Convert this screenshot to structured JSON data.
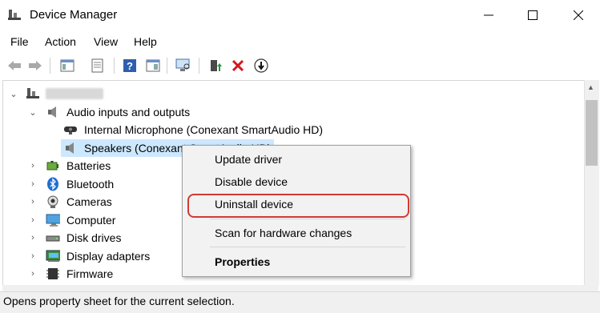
{
  "window": {
    "title": "Device Manager",
    "controls": [
      "minimize",
      "maximize",
      "close"
    ]
  },
  "menu": [
    "File",
    "Action",
    "View",
    "Help"
  ],
  "toolbar": {
    "icons": [
      "back-arrow-icon",
      "forward-arrow-icon",
      "show-hide-console-tree-icon",
      "properties-icon",
      "help-icon",
      "action-pane-icon",
      "scan-hardware-icon",
      "update-driver-icon",
      "uninstall-icon",
      "disable-device-icon"
    ]
  },
  "tree": {
    "root": "",
    "categories": [
      {
        "label": "Audio inputs and outputs",
        "expanded": true,
        "children": [
          "Internal Microphone (Conexant SmartAudio HD)",
          "Speakers (Conexant SmartAudio HD)"
        ]
      },
      {
        "label": "Batteries"
      },
      {
        "label": "Bluetooth"
      },
      {
        "label": "Cameras"
      },
      {
        "label": "Computer"
      },
      {
        "label": "Disk drives"
      },
      {
        "label": "Display adapters"
      },
      {
        "label": "Firmware"
      }
    ]
  },
  "context_menu": {
    "items": [
      "Update driver",
      "Disable device",
      "Uninstall device",
      "Scan for hardware changes",
      "Properties"
    ],
    "highlighted": "Uninstall device",
    "highlight_color": "#d23a32"
  },
  "status": "Opens property sheet for the current selection."
}
